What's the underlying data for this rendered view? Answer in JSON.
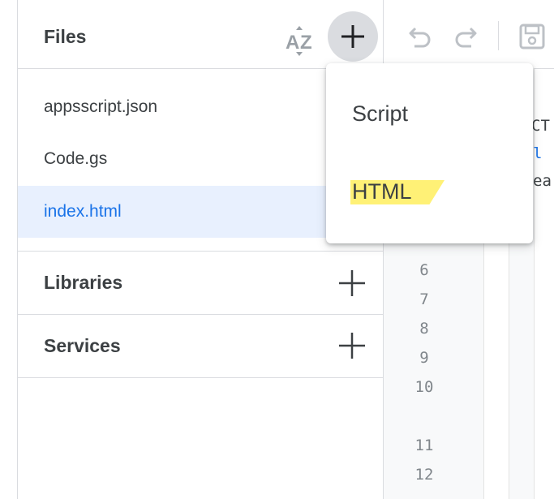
{
  "sidebar": {
    "files_title": "Files",
    "files": [
      {
        "name": "appsscript.json"
      },
      {
        "name": "Code.gs"
      },
      {
        "name": "index.html"
      }
    ],
    "libraries_title": "Libraries",
    "services_title": "Services"
  },
  "add_menu": {
    "items": [
      {
        "label": "Script"
      },
      {
        "label": "HTML"
      }
    ]
  },
  "editor": {
    "line_numbers": [
      "6",
      "7",
      "8",
      "9",
      "10",
      "11",
      "12"
    ],
    "code_fragments": [
      "CT",
      "l",
      "ea"
    ]
  },
  "icons": {
    "sort": "sort-az-icon",
    "add": "plus-icon",
    "undo": "undo-icon",
    "redo": "redo-icon",
    "save": "save-icon"
  },
  "colors": {
    "accent": "#1a73e8",
    "selected_bg": "#e8f0fe",
    "highlight": "#fff176"
  }
}
